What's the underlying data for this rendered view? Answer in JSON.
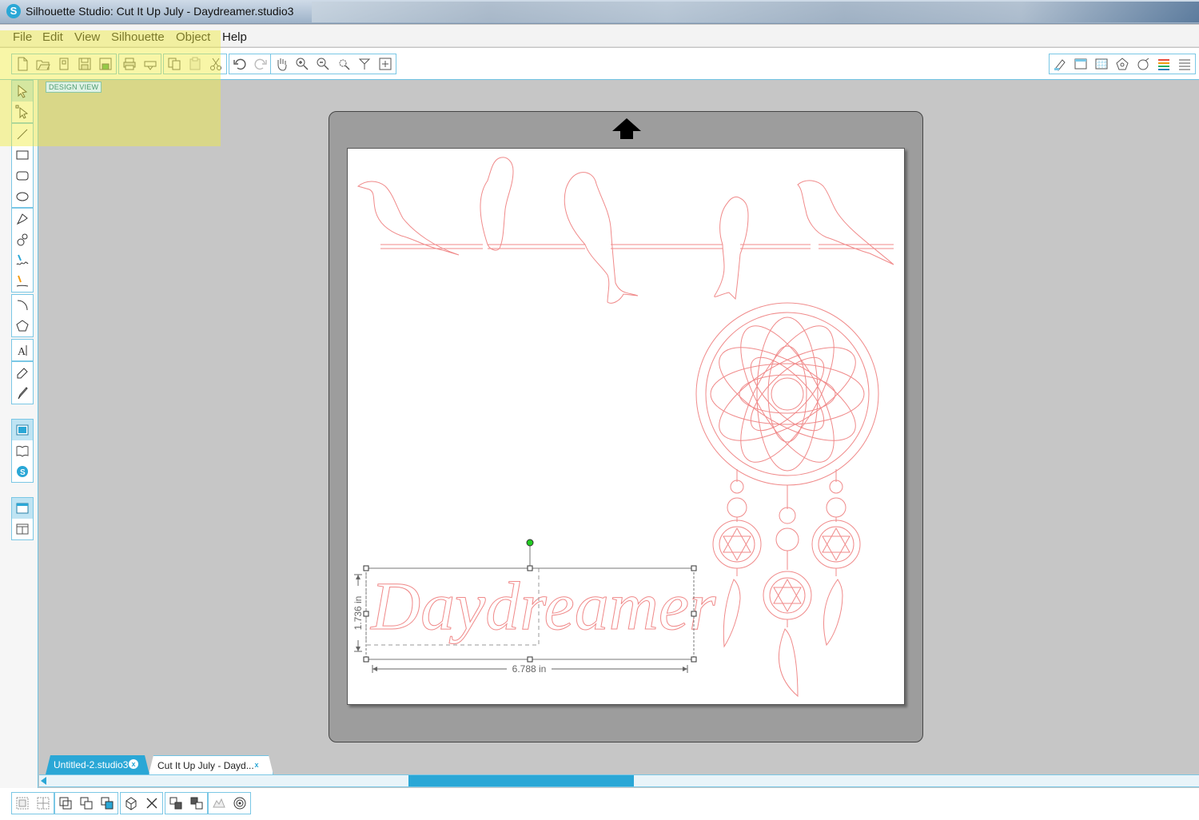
{
  "window": {
    "title": "Silhouette Studio: Cut It Up July - Daydreamer.studio3"
  },
  "menu": {
    "items": [
      "File",
      "Edit",
      "View",
      "Silhouette",
      "Object",
      "Help"
    ]
  },
  "toolbar": {
    "groups": [
      [
        "new-file-icon",
        "open-file-icon",
        "template-icon",
        "save-icon",
        "save-library-icon"
      ],
      [
        "print-icon",
        "send-to-cutter-icon"
      ],
      [
        "copy-icon",
        "paste-icon",
        "cut-scissors-icon"
      ],
      [
        "undo-icon",
        "redo-icon"
      ],
      [
        "pan-hand-icon",
        "zoom-in-icon",
        "zoom-out-icon",
        "zoom-select-icon",
        "zoom-fit-icon",
        "fit-to-page-icon"
      ]
    ],
    "right_group": [
      "page-setup-icon",
      "cut-settings-icon",
      "grid-settings-icon",
      "registration-marks-icon",
      "trace-icon",
      "fill-color-icon",
      "line-style-icon"
    ]
  },
  "left_tools": {
    "group1": [
      "select-arrow-icon",
      "edit-points-icon"
    ],
    "group2": [
      "line-tool-icon",
      "rectangle-tool-icon",
      "rounded-rectangle-tool-icon",
      "ellipse-tool-icon"
    ],
    "group3": [
      "polygon-tool-icon",
      "curve-tool-icon",
      "freehand-tool-icon",
      "smooth-freehand-tool-icon"
    ],
    "group4": [
      "arc-tool-icon",
      "regular-polygon-tool-icon"
    ],
    "group5": [
      "text-tool-icon"
    ],
    "group6": [
      "eraser-tool-icon",
      "knife-tool-icon"
    ],
    "group7": [
      "design-view-icon",
      "library-icon",
      "silhouette-store-icon"
    ],
    "group8": [
      "single-panel-icon",
      "split-panel-icon"
    ]
  },
  "design_view_label": "DESIGN VIEW",
  "canvas": {
    "text_object": "Daydreamer",
    "width_dimension": "6.788 in",
    "height_dimension": "1.736 in",
    "cut_color": "#f08a8a",
    "selection_handle_color": "#22cc22"
  },
  "tabs": [
    {
      "label": "Untitled-2.studio3",
      "close": "x",
      "active": false
    },
    {
      "label": "Cut It Up July - Dayd...",
      "close": "x",
      "active": true
    }
  ],
  "bottom_toolbar": [
    "group-icon",
    "ungroup-icon",
    "compound-path-icon",
    "release-compound-icon",
    "combine-icon",
    "offset-icon",
    "delete-icon",
    "bring-to-front-icon",
    "send-to-back-icon",
    "replicate-icon",
    "trace-bottom-icon"
  ],
  "colors": {
    "accent": "#2aa7d6",
    "highlight": "#f0eb3c"
  }
}
